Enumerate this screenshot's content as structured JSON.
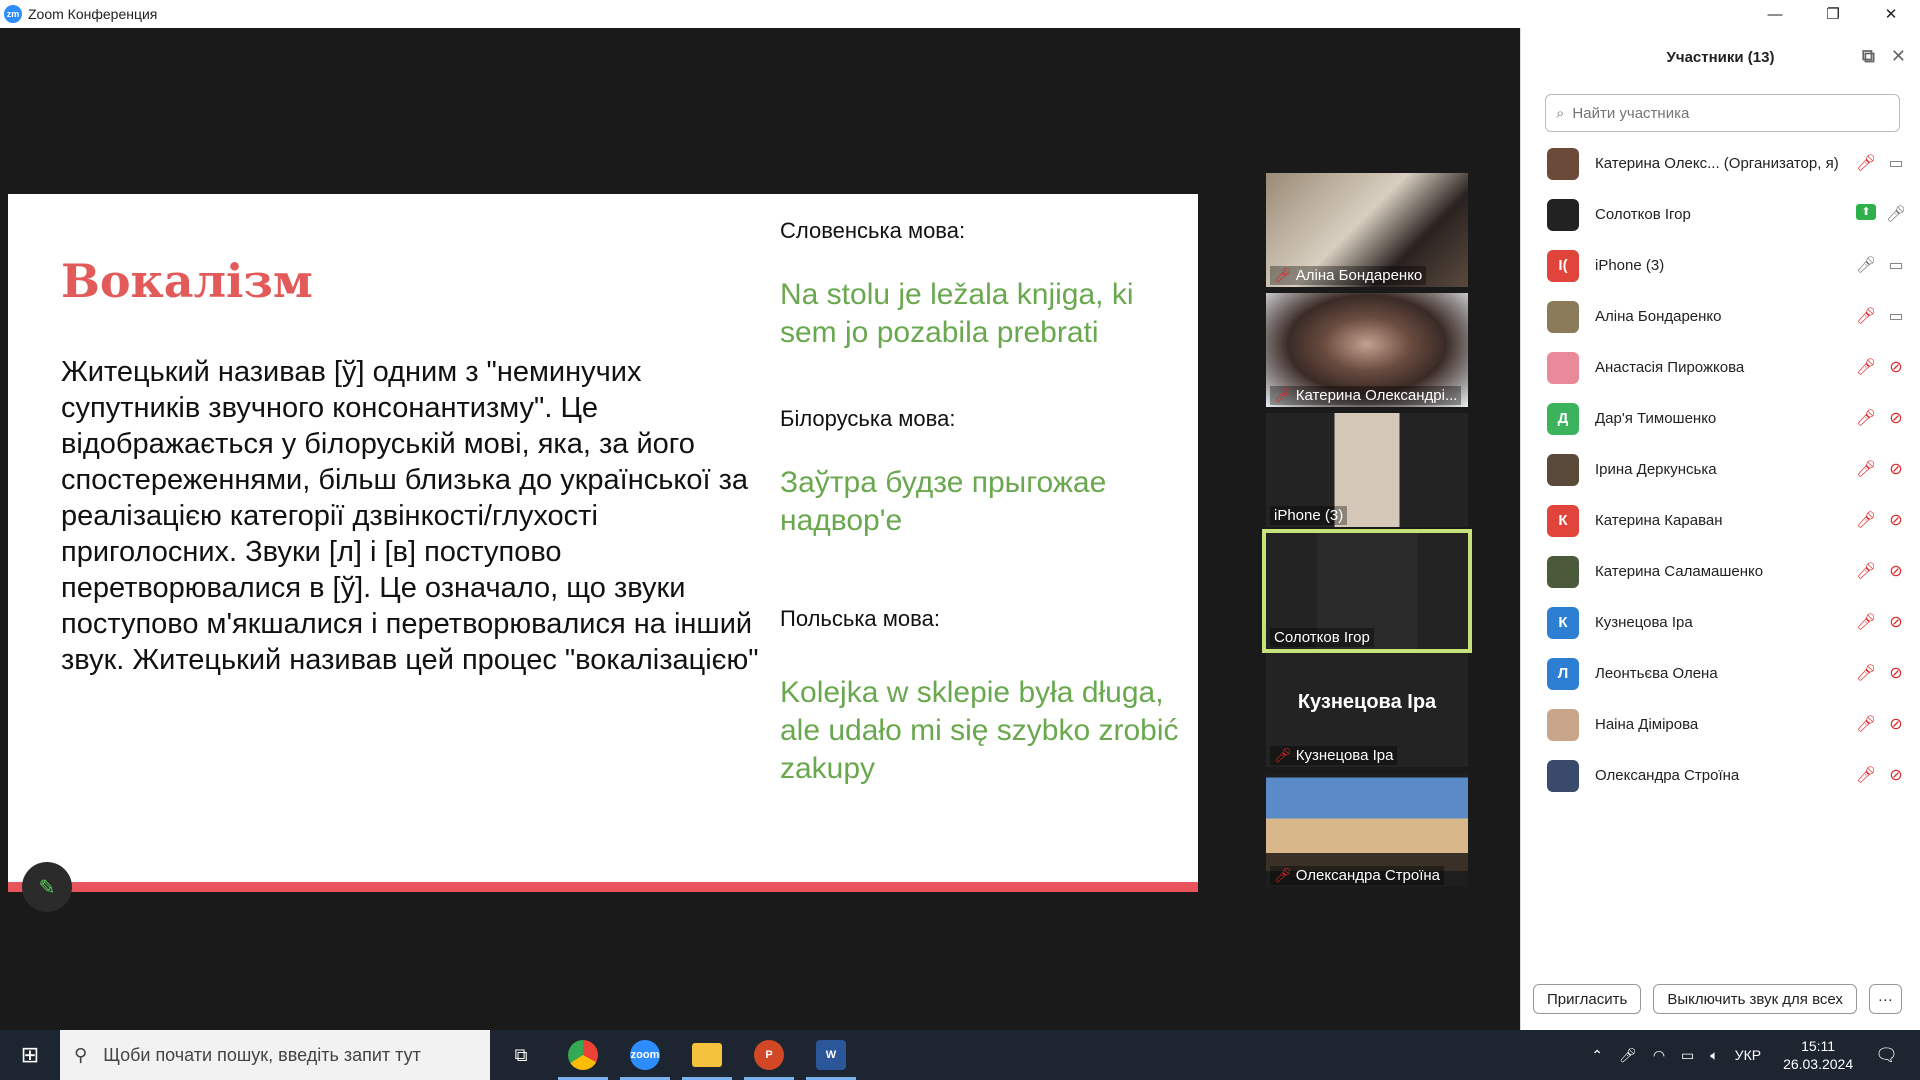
{
  "window": {
    "title": "Zoom Конференция",
    "logo_text": "zm",
    "minimize": "—",
    "restore": "❐",
    "close": "✕"
  },
  "slide": {
    "title": "Вокалізм",
    "body": "Житецький називав [ў] одним з \"неминучих супутників звучного консонантизму\". Це відображається у білоруській мові, яка, за його спостереженнями, більш близька до української за реалізацією категорії дзвінкості/глухості приголосних. Звуки [л] і [в] поступово перетворювалися в [ў]. Це означало, що звуки поступово м'якшалися і перетворювалися на інший звук. Житецький називав цей процес \"вокалізацією\"",
    "examples": [
      {
        "label": "Словенська мова:",
        "text": "Na stolu je ležala knjiga, ki sem jo pozabila prebrati"
      },
      {
        "label": "Білоруська мова:",
        "text": "Заўтра будзе прыгожае надвор'е"
      },
      {
        "label": "Польська мова:",
        "text": "Kolejka w sklepie była długa, ale udało mi się szybko zrobić zakupy"
      }
    ],
    "accent_color": "#e8535c",
    "example_color": "#6aa84f"
  },
  "tiles": [
    {
      "name": "Аліна Бондаренко",
      "muted": true
    },
    {
      "name": "Катерина Олександрі...",
      "muted": true
    },
    {
      "name": "iPhone (3)",
      "muted": false
    },
    {
      "name": "Солотков Ігор",
      "muted": false,
      "active": true
    },
    {
      "name": "Кузнецова Іра",
      "muted": true,
      "big_name": "Кузнецова Іра"
    },
    {
      "name": "Олександра Строїна",
      "muted": true
    }
  ],
  "panel": {
    "title": "Участники (13)",
    "search_placeholder": "Найти участника",
    "participants": [
      {
        "name": "Катерина Олекс... (Организатор, я)",
        "avatar": "",
        "avatar_color": "#6b4a3a"
      },
      {
        "name": "Солотков Ігор",
        "avatar": "",
        "avatar_color": "#222222"
      },
      {
        "name": "iPhone (3)",
        "avatar": "I(",
        "avatar_color": "#e0443a"
      },
      {
        "name": "Аліна Бондаренко",
        "avatar": "",
        "avatar_color": "#8a7a5a"
      },
      {
        "name": "Анастасія Пирожкова",
        "avatar": "",
        "avatar_color": "#e88a9a"
      },
      {
        "name": "Дар'я Тимошенко",
        "avatar": "Д",
        "avatar_color": "#3bb35c"
      },
      {
        "name": "Ірина Деркунська",
        "avatar": "",
        "avatar_color": "#5a4a3a"
      },
      {
        "name": "Катерина Караван",
        "avatar": "К",
        "avatar_color": "#e0443a"
      },
      {
        "name": "Катерина Саламашенко",
        "avatar": "",
        "avatar_color": "#4a5a3a"
      },
      {
        "name": "Кузнецова Іра",
        "avatar": "К",
        "avatar_color": "#2d7fd3"
      },
      {
        "name": "Леонтьєва Олена",
        "avatar": "Л",
        "avatar_color": "#2d7fd3"
      },
      {
        "name": "Наіна Дімірова",
        "avatar": "",
        "avatar_color": "#c9a58a"
      },
      {
        "name": "Олександра Строїна",
        "avatar": "",
        "avatar_color": "#3a4a6a"
      }
    ],
    "invite": "Пригласить",
    "mute_all": "Выключить звук для всех",
    "more": "···"
  },
  "taskbar": {
    "search_placeholder": "Щоби почати пошук, введіть запит тут",
    "language": "УКР",
    "time": "15:11",
    "date": "26.03.2024"
  }
}
